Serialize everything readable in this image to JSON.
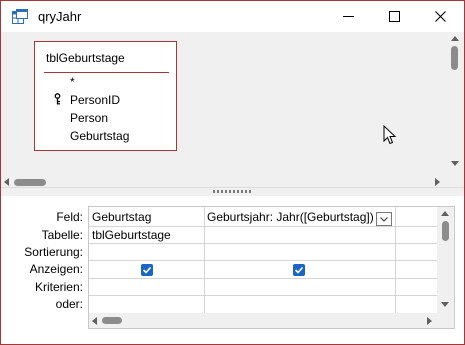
{
  "window": {
    "title": "qryJahr",
    "accent_color": "#a4373a",
    "icons": [
      "query-design-icon",
      "minimize-icon",
      "maximize-icon",
      "close-icon"
    ]
  },
  "field_list": {
    "table_name": "tblGeburtstage",
    "fields": [
      {
        "name": "*",
        "primary_key": false
      },
      {
        "name": "PersonID",
        "primary_key": true
      },
      {
        "name": "Person",
        "primary_key": false
      },
      {
        "name": "Geburtstag",
        "primary_key": false
      }
    ]
  },
  "grid": {
    "row_labels": {
      "feld": "Feld:",
      "tabelle": "Tabelle:",
      "sortierung": "Sortierung:",
      "anzeigen": "Anzeigen:",
      "kriterien": "Kriterien:",
      "oder": "oder:"
    },
    "columns": [
      {
        "feld": "Geburtstag",
        "tabelle": "tblGeburtstage",
        "anzeigen": true
      },
      {
        "feld": "Geburtsjahr: Jahr([Geburtstag])",
        "tabelle": "",
        "anzeigen": true
      }
    ],
    "checkbox_color": "#1a66c2"
  }
}
